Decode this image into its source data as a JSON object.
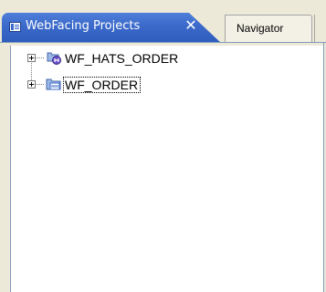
{
  "tabs": {
    "active": {
      "label": "WebFacing Projects",
      "close_glyph": "✕"
    },
    "inactive": {
      "label": "Navigator"
    }
  },
  "tree": {
    "items": [
      {
        "label": "WF_HATS_ORDER",
        "icon": "hats-project-icon",
        "expanded": false,
        "focused": false
      },
      {
        "label": "WF_ORDER",
        "icon": "webfacing-project-icon",
        "expanded": false,
        "focused": true
      }
    ]
  },
  "colors": {
    "active_tab": "#3c6bcb",
    "view_background": "#ffffff",
    "chrome": "#ece9d8"
  }
}
